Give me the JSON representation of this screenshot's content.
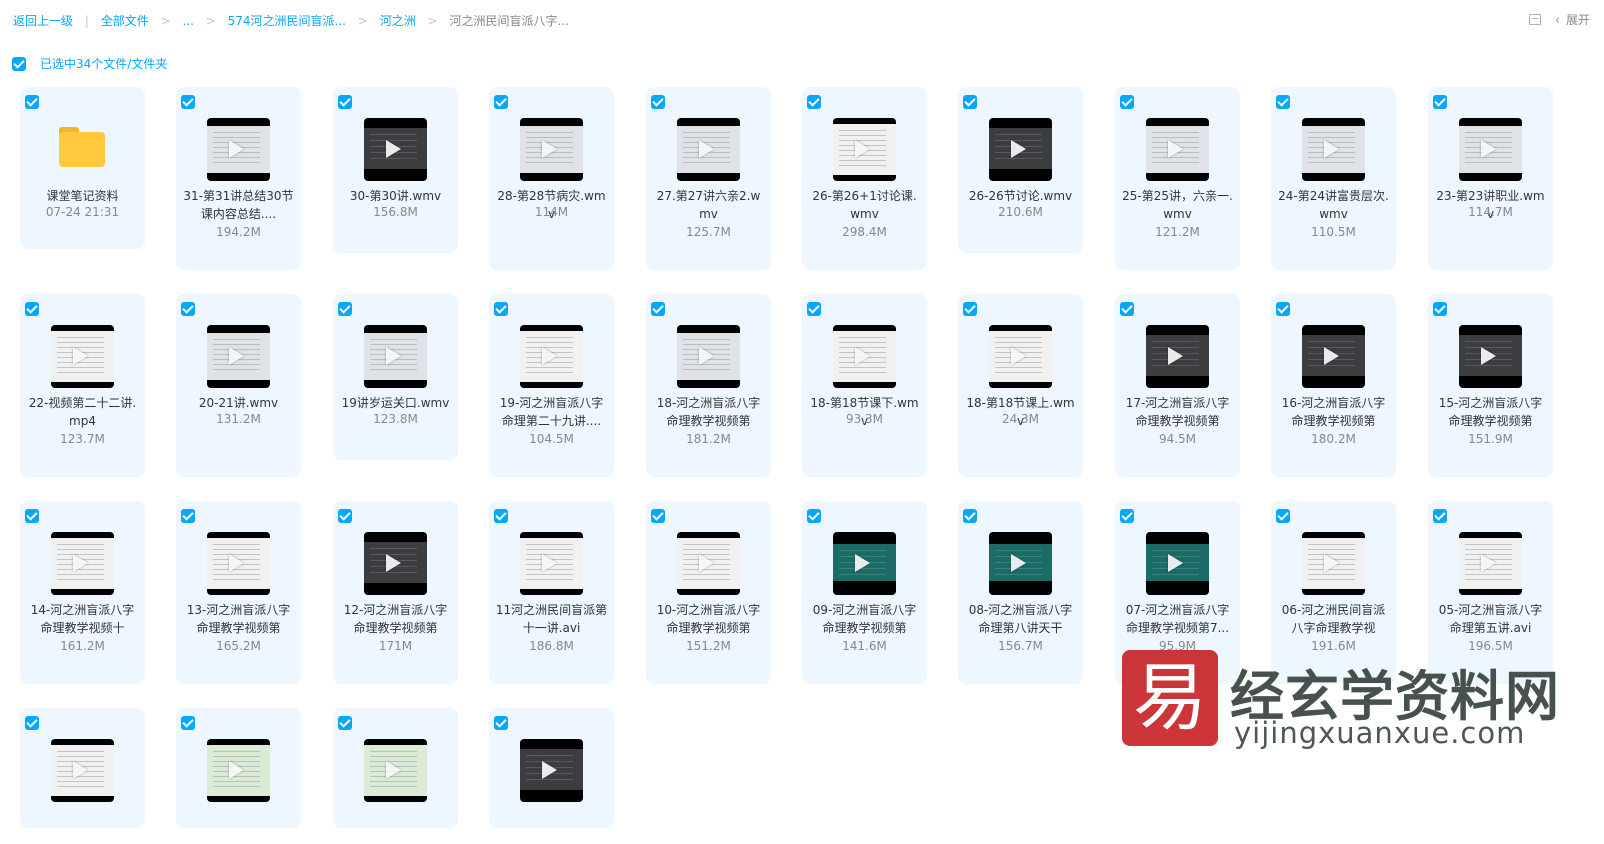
{
  "breadcrumb": {
    "items": [
      "返回上一级",
      "全部文件",
      "...",
      "574河之洲民间盲派...",
      "河之洲",
      "河之洲民间盲派八字..."
    ],
    "separator": ">"
  },
  "toolbar": {
    "expand_label": "展开",
    "expand_chevron": "‹"
  },
  "selection": {
    "label": "已选中34个文件/文件夹"
  },
  "colors": {
    "accent": "#06a7ff",
    "card_bg": "#eef7ff",
    "folder": "#ffc83d"
  },
  "files": [
    {
      "name": "课堂笔记资料",
      "meta": "07-24 21:31",
      "type": "folder"
    },
    {
      "name": "31-第31讲总结30节课内容总结....",
      "meta": "194.2M",
      "type": "video",
      "thumb": "black"
    },
    {
      "name": "30-第30讲.wmv",
      "meta": "156.8M",
      "type": "video",
      "thumb": "dark"
    },
    {
      "name": "28-第28节病灾.wmv",
      "meta": "114M",
      "type": "video",
      "thumb": "black"
    },
    {
      "name": "27.第27讲六亲2.wmv",
      "meta": "125.7M",
      "type": "video",
      "thumb": "black"
    },
    {
      "name": "26-第26+1讨论课.wmv",
      "meta": "298.4M",
      "type": "video",
      "thumb": "white"
    },
    {
      "name": "26-26节讨论.wmv",
      "meta": "210.6M",
      "type": "video",
      "thumb": "dark"
    },
    {
      "name": "25-第25讲，六亲一.wmv",
      "meta": "121.2M",
      "type": "video",
      "thumb": "black"
    },
    {
      "name": "24-第24讲富贵层次.wmv",
      "meta": "110.5M",
      "type": "video",
      "thumb": "black"
    },
    {
      "name": "23-第23讲职业.wmv",
      "meta": "114.7M",
      "type": "video",
      "thumb": "black"
    },
    {
      "name": "22-视频第二十二讲.mp4",
      "meta": "123.7M",
      "type": "video",
      "thumb": "white"
    },
    {
      "name": "20-21讲.wmv",
      "meta": "131.2M",
      "type": "video",
      "thumb": "black"
    },
    {
      "name": "19讲岁运关口.wmv",
      "meta": "123.8M",
      "type": "video",
      "thumb": "black"
    },
    {
      "name": "19-河之洲盲派八字命理第二十九讲....",
      "meta": "104.5M",
      "type": "video",
      "thumb": "white"
    },
    {
      "name": "18-河之洲盲派八字命理教学视频第",
      "meta": "181.2M",
      "type": "video",
      "thumb": "black"
    },
    {
      "name": "18-第18节课下.wmv",
      "meta": "93.3M",
      "type": "video",
      "thumb": "white"
    },
    {
      "name": "18-第18节课上.wmv",
      "meta": "24.3M",
      "type": "video",
      "thumb": "white"
    },
    {
      "name": "17-河之洲盲派八字命理教学视频第",
      "meta": "94.5M",
      "type": "video",
      "thumb": "dark"
    },
    {
      "name": "16-河之洲盲派八字命理教学视频第",
      "meta": "180.2M",
      "type": "video",
      "thumb": "dark"
    },
    {
      "name": "15-河之洲盲派八字命理教学视频第",
      "meta": "151.9M",
      "type": "video",
      "thumb": "dark"
    },
    {
      "name": "14-河之洲盲派八字命理教学视频十",
      "meta": "161.2M",
      "type": "video",
      "thumb": "white"
    },
    {
      "name": "13-河之洲盲派八字命理教学视频第",
      "meta": "165.2M",
      "type": "video",
      "thumb": "white"
    },
    {
      "name": "12-河之洲盲派八字命理教学视频第",
      "meta": "171M",
      "type": "video",
      "thumb": "dark"
    },
    {
      "name": "11河之洲民间盲派第十一讲.avi",
      "meta": "186.8M",
      "type": "video",
      "thumb": "white"
    },
    {
      "name": "10-河之洲盲派八字命理教学视频第",
      "meta": "151.2M",
      "type": "video",
      "thumb": "white"
    },
    {
      "name": "09-河之洲盲派八字命理教学视频第",
      "meta": "141.6M",
      "type": "video",
      "thumb": "teal"
    },
    {
      "name": "08-河之洲盲派八字命理第八讲天干",
      "meta": "156.7M",
      "type": "video",
      "thumb": "teal"
    },
    {
      "name": "07-河之洲盲派八字命理教学视频第7...",
      "meta": "95.9M",
      "type": "video",
      "thumb": "teal"
    },
    {
      "name": "06-河之洲民间盲派八字命理教学视",
      "meta": "191.6M",
      "type": "video",
      "thumb": "white"
    },
    {
      "name": "05-河之洲盲派八字命理第五讲.avi",
      "meta": "196.5M",
      "type": "video",
      "thumb": "white"
    },
    {
      "name": "",
      "meta": "",
      "type": "video",
      "thumb": "white"
    },
    {
      "name": "",
      "meta": "",
      "type": "video",
      "thumb": "green"
    },
    {
      "name": "",
      "meta": "",
      "type": "video",
      "thumb": "green"
    },
    {
      "name": "",
      "meta": "",
      "type": "video",
      "thumb": "dark"
    }
  ],
  "watermark": {
    "logo_char": "易",
    "title": "经玄学资料网",
    "url": "yijingxuanxue.com"
  }
}
